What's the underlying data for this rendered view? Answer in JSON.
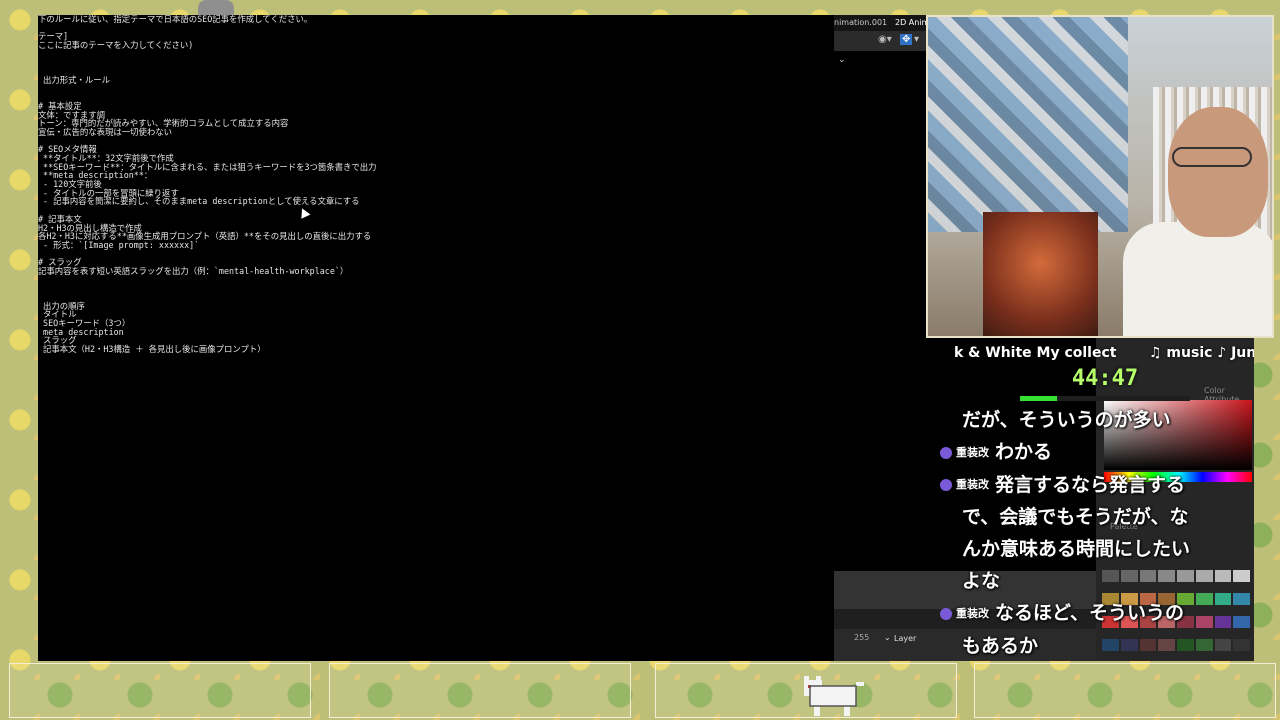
{
  "terminal": {
    "lines": [
      "下のルールに従い、指定テーマで日本語のSEO記事を作成してください。",
      "",
      "テーマ]",
      "ここに記事のテーマを入力してください)",
      "",
      "",
      "",
      " 出力形式・ルール",
      "",
      "",
      "# 基本設定",
      "文体：ですます調",
      "トーン：専門的だが読みやすい、学術的コラムとして成立する内容",
      "宣伝・広告的な表現は一切使わない",
      "",
      "# SEOメタ情報",
      " **タイトル**：32文字前後で作成",
      " **SEOキーワード**：タイトルに含まれる、または狙うキーワードを3つ箇条書きで出力",
      " **meta description**：",
      " - 120文字前後",
      " - タイトルの一部を冒頭に繰り返す",
      " - 記事内容を簡潔に要約し、そのままmeta descriptionとして使える文章にする",
      "",
      "# 記事本文",
      "H2・H3の見出し構造で作成",
      "各H2・H3に対応する**画像生成用プロンプト（英語）**をその見出しの直後に出力する",
      " - 形式：`[Image prompt: xxxxxx]`",
      "",
      "# スラッグ",
      "記事内容を表す短い英語スラッグを出力（例：`mental-health-workplace`）",
      "",
      "",
      "",
      " 出力の順序",
      " タイトル",
      " SEOキーワード（3つ）",
      " meta description",
      " スラッグ",
      " 記事本文（H2・H3構造 ＋ 各見出し後に画像プロンプト）"
    ]
  },
  "app": {
    "tab1": "nimation.001",
    "tab2": "2D Anim",
    "frame_value": "255",
    "layer_label": "Layer",
    "color_attribute_label": "Color Attribute",
    "palette_label": "Palette"
  },
  "ticker": {
    "segment1": "k & White My collect",
    "segment2": "♫ music ♪ Jun"
  },
  "timer": {
    "time": "44:47",
    "progress_percent": 22
  },
  "chat": {
    "rows": [
      {
        "nick": "",
        "text": "だが、そういうのが多い",
        "style": "indent"
      },
      {
        "nick": "重装改",
        "text": "わかる",
        "style": "badge"
      },
      {
        "nick": "重装改",
        "text": "発言するなら発言する",
        "style": "badge"
      },
      {
        "nick": "",
        "text": "で、会議でもそうだが、な",
        "style": "indent"
      },
      {
        "nick": "",
        "text": "んか意味ある時間にしたい",
        "style": "indent"
      },
      {
        "nick": "",
        "text": "よな",
        "style": "indent"
      },
      {
        "nick": "重装改",
        "text": "なるほど、そういうの",
        "style": "badge"
      },
      {
        "nick": "",
        "text": "もあるか",
        "style": "indent"
      }
    ]
  },
  "colors": {
    "timer_green": "#b8ff6c",
    "badge_purple": "#7a5ad8"
  }
}
